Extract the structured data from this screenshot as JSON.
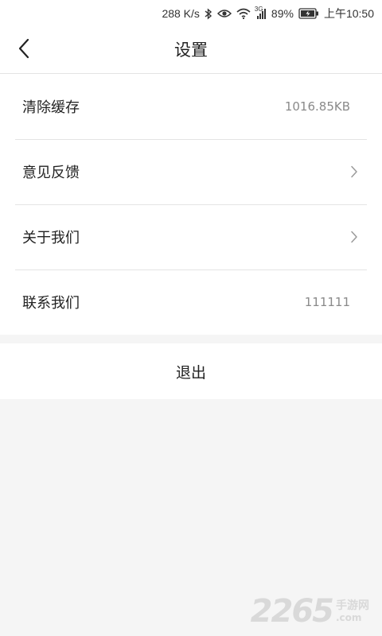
{
  "status_bar": {
    "net_speed": "288 K/s",
    "network_type": "3G",
    "battery": "89%",
    "time": "上午10:50",
    "icons": [
      "bluetooth-icon",
      "eye-icon",
      "wifi-icon",
      "signal-icon",
      "battery-icon"
    ]
  },
  "header": {
    "back_icon": "chevron-left-icon",
    "title": "设置"
  },
  "settings": {
    "items": [
      {
        "label": "清除缓存",
        "value": "1016.85KB"
      },
      {
        "label": "意见反馈",
        "icon": "chevron-right-icon"
      },
      {
        "label": "关于我们",
        "icon": "chevron-right-icon"
      },
      {
        "label": "联系我们",
        "value": "111111"
      }
    ]
  },
  "logout": {
    "label": "退出"
  },
  "watermark": {
    "number": "2265",
    "text_cn": "手游网",
    "text_com": ".com"
  }
}
